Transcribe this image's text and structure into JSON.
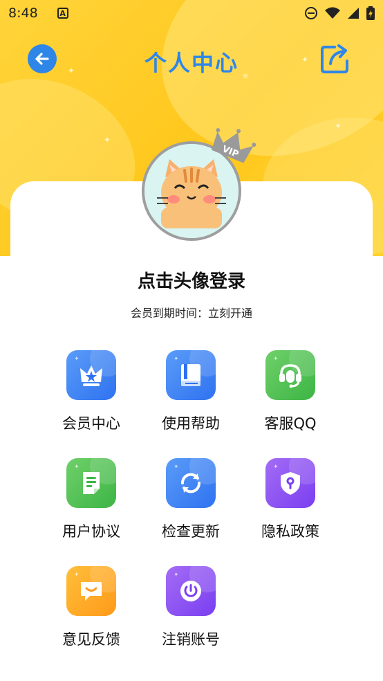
{
  "status_bar": {
    "time": "8:48",
    "notification_icon": "a-icon",
    "icons": [
      "dnd-icon",
      "wifi-icon",
      "signal-icon",
      "battery-icon"
    ]
  },
  "header": {
    "title": "个人中心",
    "back_icon": "back-arrow-icon",
    "share_icon": "share-icon"
  },
  "profile": {
    "login_prompt": "点击头像登录",
    "member_expiry": "会员到期时间：立刻开通",
    "badge_text": "VIP"
  },
  "menu": {
    "items": [
      {
        "label": "会员中心",
        "icon": "crown-icon",
        "color": "#3d83f4"
      },
      {
        "label": "使用帮助",
        "icon": "book-icon",
        "color": "#3d83f4"
      },
      {
        "label": "客服QQ",
        "icon": "headset-icon",
        "color": "#4cbf4e"
      },
      {
        "label": "用户协议",
        "icon": "document-icon",
        "color": "#4cbf4e"
      },
      {
        "label": "检查更新",
        "icon": "refresh-icon",
        "color": "#3d83f4"
      },
      {
        "label": "隐私政策",
        "icon": "shield-icon",
        "color": "#8a4ef2"
      },
      {
        "label": "意见反馈",
        "icon": "feedback-icon",
        "color": "#ffab22"
      },
      {
        "label": "注销账号",
        "icon": "power-icon",
        "color": "#8a4ef2"
      }
    ]
  },
  "colors": {
    "accent": "#2e86e8",
    "header_bg": "#ffc71c"
  }
}
